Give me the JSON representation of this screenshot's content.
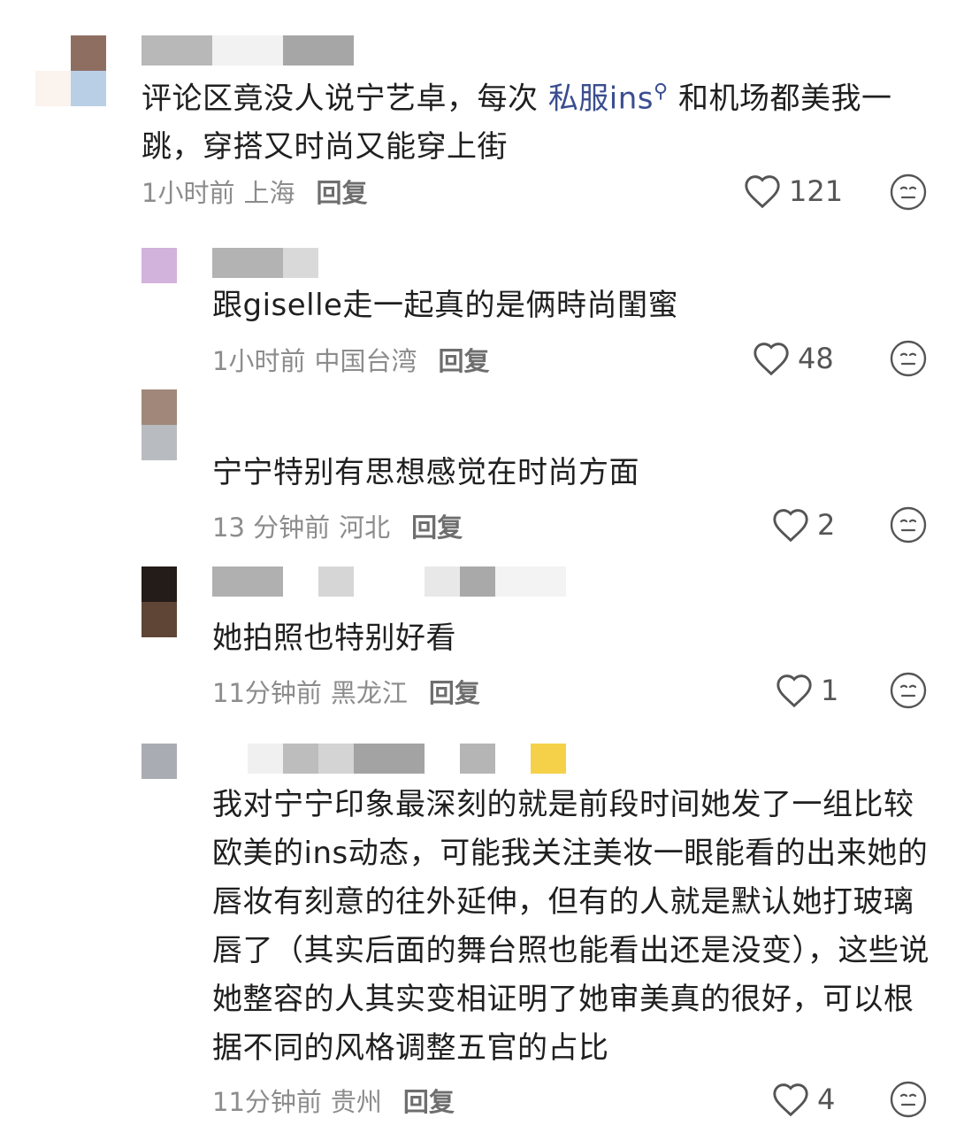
{
  "comments": [
    {
      "text_plain_before": "评论区竟没人说宁艺卓，每次 ",
      "link": "私服ins",
      "text_after_line1": " 和机场都美我一",
      "text_line2": "跳，穿搭又时尚又能穿上街",
      "time": "1小时前",
      "location": "上海",
      "reply": "回复",
      "likes": "121"
    },
    {
      "text": "跟giselle走一起真的是俩時尚閨蜜",
      "time": "1小时前",
      "location": "中国台湾",
      "reply": "回复",
      "likes": "48"
    },
    {
      "text": "宁宁特别有思想感觉在时尚方面",
      "time": "13 分钟前",
      "location": "河北",
      "reply": "回复",
      "likes": "2"
    },
    {
      "text": "她拍照也特别好看",
      "time": "11分钟前",
      "location": "黑龙江",
      "reply": "回复",
      "likes": "1"
    },
    {
      "lines": [
        "我对宁宁印象最深刻的就是前段时间她发了一组比较",
        "欧美的ins动态，可能我关注美妆一眼能看的出来她的",
        "唇妆有刻意的往外延伸，但有的人就是默认她打玻璃",
        "唇了（其实后面的舞台照也能看出还是没变），这些说",
        "她整容的人其实变相证明了她审美真的很好，可以根",
        "据不同的风格调整五官的占比"
      ],
      "time": "11分钟前",
      "location": "贵州",
      "reply": "回复",
      "likes": "4"
    }
  ],
  "icons": {
    "like": "heart-outline-icon",
    "emoji": "neutral-face-icon",
    "search": "search-icon"
  },
  "colors": {
    "link": "#3a4d8f",
    "meta": "#8c8c8c",
    "text": "#1f1f1f"
  }
}
